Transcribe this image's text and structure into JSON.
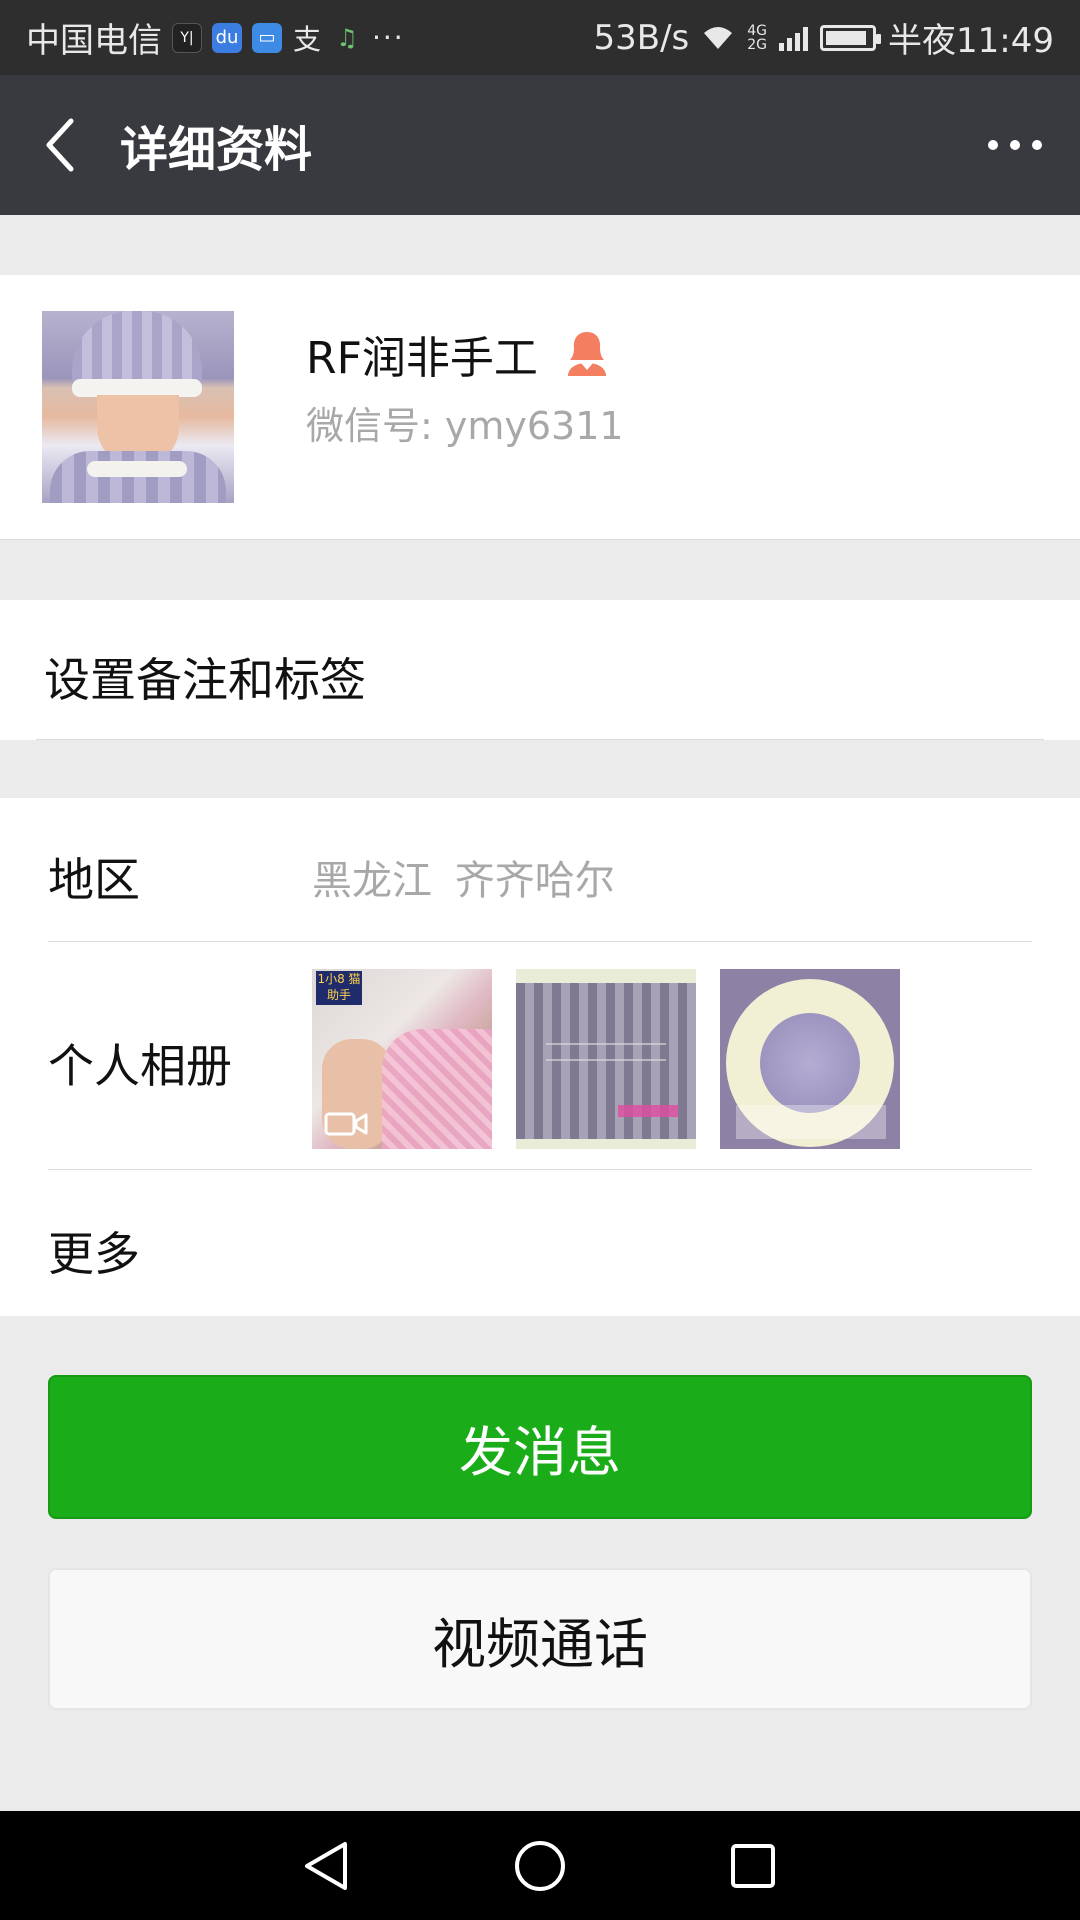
{
  "status_bar": {
    "carrier": "中国电信",
    "speed": "53B/s",
    "network": "4G 2G",
    "time": "半夜11:49",
    "more": "···",
    "icons": [
      "yi-app-icon",
      "baidu-icon",
      "message-app-icon",
      "alipay-icon",
      "chat-app-icon",
      "wifi-icon",
      "signal-icon",
      "battery-icon"
    ],
    "battery_level": 0.9
  },
  "title_bar": {
    "title": "详细资料",
    "icons": [
      "back-icon",
      "more-icon"
    ]
  },
  "profile": {
    "nickname": "RF润非手工",
    "wechat_id": "微信号: ymy6311",
    "gender_icon": "female-icon",
    "gender_color": "#f37e60"
  },
  "remark": {
    "label": "设置备注和标签"
  },
  "info": {
    "region_label": "地区",
    "region_value": "黑龙江  齐齐哈尔",
    "album_label": "个人相册",
    "more_label": "更多",
    "album_thumbs": [
      "video-thumbnail",
      "knit-thumbnail",
      "flower-thumbnail"
    ],
    "thumb1_badge": "1小8 猫助手"
  },
  "actions": {
    "send_message": "发消息",
    "video_call": "视频通话",
    "accent_color": "#1aad19"
  },
  "nav_bar": {
    "icons": [
      "nav-back-icon",
      "nav-home-icon",
      "nav-recents-icon"
    ]
  }
}
